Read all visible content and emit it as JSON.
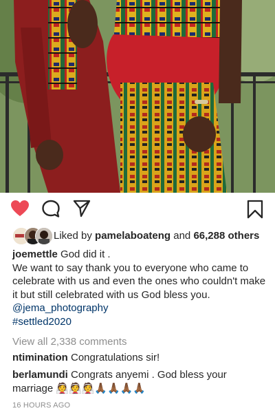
{
  "post": {
    "photo_description_icon": "couple-kente-photo",
    "liked": true,
    "like_color": "#ed4956"
  },
  "actions": {
    "like_icon": "heart-icon",
    "comment_icon": "comment-icon",
    "share_icon": "send-icon",
    "save_icon": "bookmark-icon"
  },
  "likes": {
    "prefix": "Liked by ",
    "user": "pamelaboateng",
    "connector": " and ",
    "count": "66,288 others"
  },
  "caption": {
    "username": "joemettle",
    "first_line": " God did it .",
    "body": "We want to say thank you to everyone who came to celebrate with us and even the ones who couldn't make it but still celebrated with us God bless you.",
    "mention": "@jema_photography",
    "hashtag": "#settled2020"
  },
  "view_all": "View all 2,338 comments",
  "comments": [
    {
      "username": "ntimination",
      "text": " Congratulations sir!"
    },
    {
      "username": "berlamundi",
      "text": " Congrats anyemi . God bless your marriage 👰👰👰🙏🏾🙏🏾🙏🏾🙏🏾"
    }
  ],
  "timestamp": "16 HOURS AGO"
}
